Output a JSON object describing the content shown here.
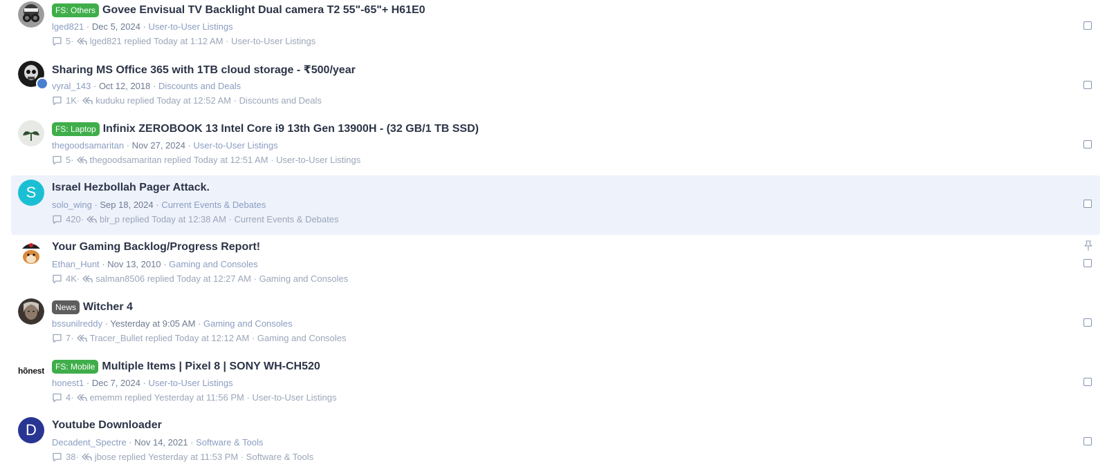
{
  "threads": [
    {
      "prefix": "FS: Others",
      "prefix_color": "green",
      "title": "Govee Envisual TV Backlight Dual camera T2 55\"-65\"+ H61E0",
      "author": "lged821",
      "date": "Dec 5, 2024",
      "category": "User-to-User Listings",
      "replies": "5",
      "last_replier": "lged821",
      "replied_label": "replied",
      "last_reply_time": "Today at 1:12 AM",
      "last_category": "User-to-User Listings",
      "avatar": {
        "type": "image",
        "desc": "gas-mask-avatar"
      },
      "highlighted": false,
      "pinned": false
    },
    {
      "prefix": "",
      "title": "Sharing MS Office 365 with 1TB cloud storage - ₹500/year",
      "author": "vyral_143",
      "date": "Oct 12, 2018",
      "category": "Discounts and Deals",
      "replies": "1K",
      "last_replier": "kuduku",
      "replied_label": "replied",
      "last_reply_time": "Today at 12:52 AM",
      "last_category": "Discounts and Deals",
      "avatar": {
        "type": "image",
        "desc": "skull-avatar"
      },
      "highlighted": false,
      "pinned": false
    },
    {
      "prefix": "FS: Laptop",
      "prefix_color": "green",
      "title": "Infinix ZEROBOOK 13 Intel Core i9 13th Gen 13900H - (32 GB/1 TB SSD)",
      "author": "thegoodsamaritan",
      "date": "Nov 27, 2024",
      "category": "User-to-User Listings",
      "replies": "5",
      "last_replier": "thegoodsamaritan",
      "replied_label": "replied",
      "last_reply_time": "Today at 12:51 AM",
      "last_category": "User-to-User Listings",
      "avatar": {
        "type": "image",
        "desc": "plant-avatar"
      },
      "highlighted": false,
      "pinned": false
    },
    {
      "prefix": "",
      "title": "Israel Hezbollah Pager Attack.",
      "author": "solo_wing",
      "date": "Sep 18, 2024",
      "category": "Current Events & Debates",
      "replies": "420",
      "last_replier": "blr_p",
      "replied_label": "replied",
      "last_reply_time": "Today at 12:38 AM",
      "last_category": "Current Events & Debates",
      "avatar": {
        "type": "letter",
        "letter": "S",
        "color": "#1bbfd3"
      },
      "highlighted": true,
      "pinned": false
    },
    {
      "prefix": "",
      "title": "Your Gaming Backlog/Progress Report!",
      "author": "Ethan_Hunt",
      "date": "Nov 13, 2010",
      "category": "Gaming and Consoles",
      "replies": "4K",
      "last_replier": "salman8506",
      "replied_label": "replied",
      "last_reply_time": "Today at 12:27 AM",
      "last_category": "Gaming and Consoles",
      "avatar": {
        "type": "image",
        "desc": "fox-avatar"
      },
      "highlighted": false,
      "pinned": true
    },
    {
      "prefix": "News",
      "prefix_color": "dark",
      "title": "Witcher 4",
      "author": "bssunilreddy",
      "date": "Yesterday at 9:05 AM",
      "category": "Gaming and Consoles",
      "replies": "7",
      "last_replier": "Tracer_Bullet",
      "replied_label": "replied",
      "last_reply_time": "Today at 12:12 AM",
      "last_category": "Gaming and Consoles",
      "avatar": {
        "type": "image",
        "desc": "witcher-avatar"
      },
      "highlighted": false,
      "pinned": false
    },
    {
      "prefix": "FS: Mobile",
      "prefix_color": "green",
      "title": "Multiple Items | Pixel 8 | SONY WH-CH520",
      "author": "honest1",
      "date": "Dec 7, 2024",
      "category": "User-to-User Listings",
      "replies": "4",
      "last_replier": "ememm",
      "replied_label": "replied",
      "last_reply_time": "Yesterday at 11:56 PM",
      "last_category": "User-to-User Listings",
      "avatar": {
        "type": "wordmark",
        "text": "hõnest"
      },
      "highlighted": false,
      "pinned": false
    },
    {
      "prefix": "",
      "title": "Youtube Downloader",
      "author": "Decadent_Spectre",
      "date": "Nov 14, 2021",
      "category": "Software & Tools",
      "replies": "38",
      "last_replier": "jbose",
      "replied_label": "replied",
      "last_reply_time": "Yesterday at 11:53 PM",
      "last_category": "Software & Tools",
      "avatar": {
        "type": "letter",
        "letter": "D",
        "color": "#283593"
      },
      "highlighted": false,
      "pinned": false
    }
  ],
  "colors": {
    "prefix_green": "#3fae4a",
    "prefix_dark": "#5d5d5d",
    "highlight_row": "#eef2fb"
  }
}
